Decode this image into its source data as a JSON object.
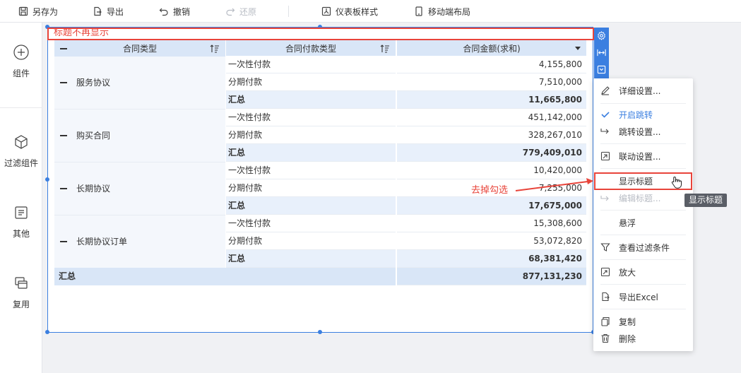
{
  "toolbar": {
    "save_as": "另存为",
    "export": "导出",
    "undo": "撤销",
    "redo": "还原",
    "dashboard_style": "仪表板样式",
    "mobile_layout": "移动端布局"
  },
  "sidebar": {
    "items": [
      {
        "label": "组件"
      },
      {
        "label": "过滤组件"
      },
      {
        "label": "其他"
      },
      {
        "label": "复用"
      }
    ]
  },
  "widget": {
    "title": "标题不再显示",
    "headers": {
      "contract_type": "合同类型",
      "payment_type": "合同付款类型",
      "amount": "合同金额(求和)"
    },
    "groups": [
      {
        "name": "服务协议",
        "rows": [
          {
            "type": "一次性付款",
            "amount": "4,155,800"
          },
          {
            "type": "分期付款",
            "amount": "7,510,000"
          },
          {
            "type": "汇总",
            "amount": "11,665,800"
          }
        ]
      },
      {
        "name": "购买合同",
        "rows": [
          {
            "type": "一次性付款",
            "amount": "451,142,000"
          },
          {
            "type": "分期付款",
            "amount": "328,267,010"
          },
          {
            "type": "汇总",
            "amount": "779,409,010"
          }
        ]
      },
      {
        "name": "长期协议",
        "rows": [
          {
            "type": "一次性付款",
            "amount": "10,420,000"
          },
          {
            "type": "分期付款",
            "amount": "7,255,000"
          },
          {
            "type": "汇总",
            "amount": "17,675,000"
          }
        ]
      },
      {
        "name": "长期协议订单",
        "rows": [
          {
            "type": "一次性付款",
            "amount": "15,308,600"
          },
          {
            "type": "分期付款",
            "amount": "53,072,820"
          },
          {
            "type": "汇总",
            "amount": "68,381,420"
          }
        ]
      }
    ],
    "grand_total": {
      "label": "汇总",
      "amount": "877,131,230"
    }
  },
  "menu": {
    "items": [
      {
        "label": "详细设置...",
        "icon": "pencil-icon"
      },
      {
        "label": "开启跳转",
        "icon": "check-icon",
        "state": "active"
      },
      {
        "label": "跳转设置...",
        "icon": "jump-icon"
      },
      {
        "label": "联动设置...",
        "icon": "link-icon"
      },
      {
        "label": "显示标题",
        "icon": "none"
      },
      {
        "label": "编辑标题...",
        "icon": "edit-title-icon",
        "state": "disabled"
      },
      {
        "label": "悬浮",
        "icon": "none"
      },
      {
        "label": "查看过滤条件",
        "icon": "filter-icon"
      },
      {
        "label": "放大",
        "icon": "maximize-icon"
      },
      {
        "label": "导出Excel",
        "icon": "export-excel-icon"
      },
      {
        "label": "复制",
        "icon": "copy-icon"
      },
      {
        "label": "删除",
        "icon": "trash-icon"
      }
    ]
  },
  "annotation": "去掉勾选",
  "tooltip": "显示标题",
  "colors": {
    "accent": "#3b7fe0",
    "highlight": "#e8443a",
    "header_bg": "#d9e6f7"
  }
}
